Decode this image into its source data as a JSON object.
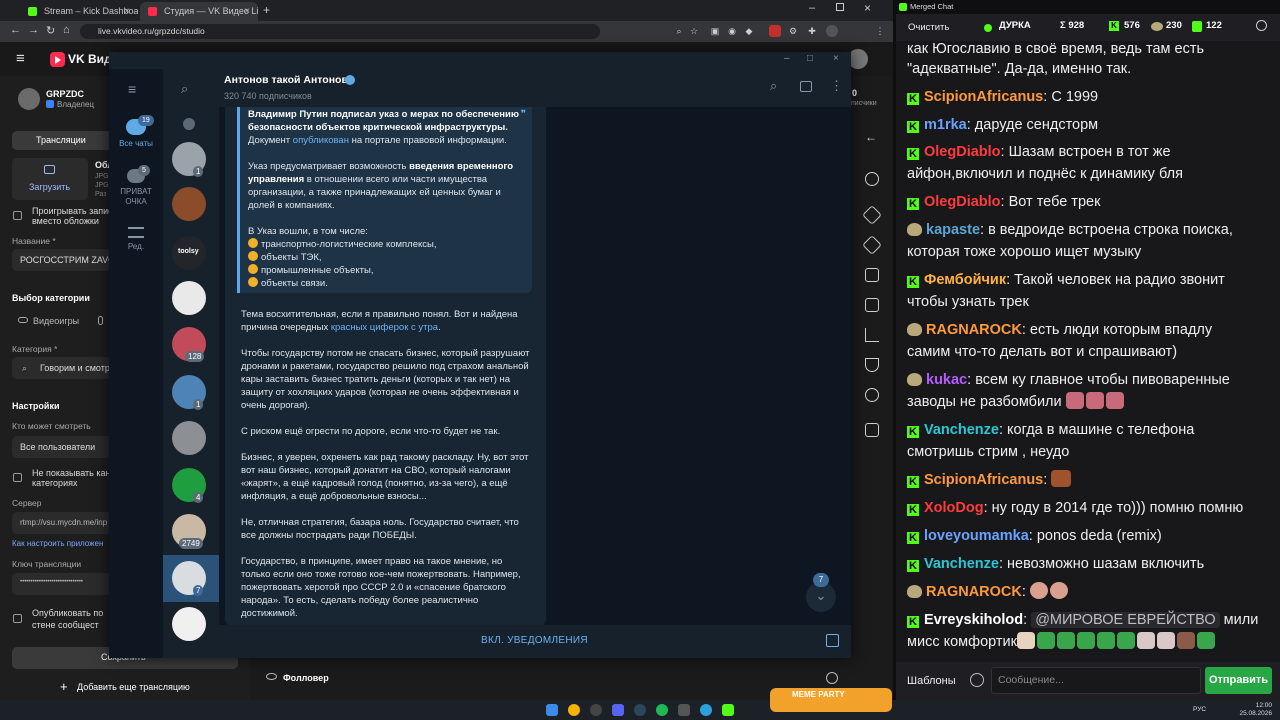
{
  "browser": {
    "tabs": [
      {
        "title": "Stream – Kick Dashboard",
        "color": "#53fc18"
      },
      {
        "title": "Студия — VK Видео Live",
        "color": "#ff2b4f"
      }
    ],
    "url": "live.vkvideo.ru/grpzdc/studio"
  },
  "vk": {
    "title": "VK Видео",
    "channel": "GRPZDC",
    "role": "Владелец",
    "tab_streams": "Трансляции",
    "cover_title": "Обл",
    "cover_hint1": "JPG",
    "cover_hint2": "JPG",
    "cover_hint3": "Раз",
    "upload": "Загрузить",
    "play_record_line1": "Проигрывать запис",
    "play_record_line2": "вместо обложки",
    "name_label": "Название *",
    "name_value": "РОСГОССТРИМ ZAVO",
    "category_choice": "Выбор категории",
    "category_games": "Видеоигры",
    "category_label": "Категория *",
    "category_value": "Говорим и смотри",
    "settings": "Настройки",
    "who_can_watch": "Кто может смотреть",
    "audience": "Все пользователи",
    "hide_line1": "Не показывать кан",
    "hide_line2": "категориях",
    "server_label": "Сервер",
    "server_value": "rtmp://vsu.mycdn.me/inp",
    "app_setup": "Как настроить приложен",
    "key_label": "Ключ трансляции",
    "key_value": "••••••••••••••••••••••••••••••",
    "publish_line1": "Опубликовать по",
    "publish_line2": "стене сообщест",
    "save": "Сохранить",
    "add_stream": "Добавить еще трансляцию",
    "follower": "Фолловер",
    "top_right_count": "0",
    "top_right_label": "писчики"
  },
  "tg": {
    "all_chats": "Все чаты",
    "all_chats_badge": "19",
    "private": "ПРИВАТ",
    "private2": "ОЧКА",
    "private_badge": "5",
    "edit": "Ред.",
    "channel_name": "Антонов такой Антонов",
    "subscribers": "320 740 подписчиков",
    "chat_badges": [
      "1",
      "128",
      "1",
      "4",
      "2749",
      "7"
    ],
    "toolsy": "toolsy",
    "quote": {
      "l1": "Владимир Путин подписал указ о мерах по обеспечению",
      "l2": "безопасности объектов критической инфраструктуры.",
      "l3a": "Документ ",
      "l3b": "опубликован",
      "l3c": " на портале правовой информации.",
      "l4a": "Указ предусматривает возможность ",
      "l4b": "введения временного",
      "l5a": "управления",
      "l5b": " в отношении всего или части имущества",
      "l6": "организации, а также принадлежащих ей ценных бумаг и",
      "l7": "долей в компаниях.",
      "l8": "В Указ вошли, в том числе:",
      "items": [
        "транспортно-логистические комплексы,",
        "объекты ТЭК,",
        "промышленные объекты,",
        "объекты связи."
      ]
    },
    "body": {
      "p1a": "Тема восхитительная, если я правильно понял. Вот и найдена",
      "p1b": "причина очередных ",
      "p1c": "красных циферок с утра",
      "p1d": ".",
      "p2a": "Чтобы государству потом не спасать бизнес, который разрушают",
      "p2b": "дронами и ракетами, государство решило под страхом анальной",
      "p2c": "кары заставить бизнес тратить деньги (которых и так нет) на",
      "p2d": "защиту от хохляцких ударов (которая не очень эффективная и",
      "p2e": "очень дорогая).",
      "p3": "С риском ещё огрести по дороге, если что-то будет не так.",
      "p4a": "Бизнес, я уверен, охренеть как рад такому раскладу. Ну, вот этот",
      "p4b": "вот наш бизнес, который донатит на СВО, который налогами",
      "p4c": "«жарят», а ещё кадровый голод (понятно, из-за чего), а ещё",
      "p4d": "инфляция, а ещё добровольные взносы...",
      "p5a": "Не, отличная стратегия, базара ноль. Государство считает, что",
      "p5b": "все должны пострадать ради ПОБЕДЫ.",
      "p6a": "Государство, в принципе, имеет право на такое мнение, но",
      "p6b": "только если оно тоже готово кое-чем пожертвовать. Например,",
      "p6c": "пожертвовать херотой про СССР 2.0 и «спасение братского",
      "p6d": "народа». То есть, сделать победу более реалистично",
      "p6e": "достижимой."
    },
    "scroll_badge": "7",
    "notify": "ВКЛ. УВЕДОМЛЕНИЯ"
  },
  "chat": {
    "window_title": "Merged Chat",
    "clear": "Очистить",
    "live_label": "ДУРКА",
    "total": "Σ 928",
    "kick": "576",
    "vk": "230",
    "other": "122",
    "messages": [
      {
        "user": "",
        "color": "#efeff1",
        "text": "как Югославию в своё время, ведь там есть"
      },
      {
        "user": "",
        "color": "#efeff1",
        "text": "\"адекватные\". Да-да, именно так."
      },
      {
        "user": "ScipionAfricanus",
        "color": "#ff9a3c",
        "text": "С 1999"
      },
      {
        "user": "m1rka",
        "color": "#6aa2ff",
        "text": "даруде сендсторм"
      },
      {
        "user": "OlegDiablo",
        "color": "#ff3c3c",
        "text": "Шазам встроен в тот же"
      },
      {
        "user": "",
        "color": "#efeff1",
        "text": "айфон,включил и поднёс к динамику бля"
      },
      {
        "user": "OlegDiablo",
        "color": "#ff3c3c",
        "text": "Вот тебе трек"
      },
      {
        "user": "kapaste",
        "color": "#5aa7d6",
        "text": "в ведроиде встроена строка поиска,"
      },
      {
        "user": "",
        "color": "#efeff1",
        "text": "которая тоже хорошо ищет музыку"
      },
      {
        "user": "Фембойчик",
        "color": "#ffb23c",
        "text": "Такой человек на радио звонит"
      },
      {
        "user": "",
        "color": "#efeff1",
        "text": "чтобы узнать трек"
      },
      {
        "user": "RAGNAROCK",
        "color": "#ff9a3c",
        "text": "есть люди которым впадлу"
      },
      {
        "user": "",
        "color": "#efeff1",
        "text": "самим что-то делать вот и спрашивают)"
      },
      {
        "user": "kukac",
        "color": "#b45cff",
        "text": "всем ку главное чтобы пивоваренные"
      },
      {
        "user": "",
        "color": "#efeff1",
        "text": "заводы не разбомбили"
      },
      {
        "user": "Vanchenze",
        "color": "#2ac8d6",
        "text": "когда в машине с телефона"
      },
      {
        "user": "",
        "color": "#efeff1",
        "text": "смотришь стрим , неудо"
      },
      {
        "user": "ScipionAfricanus",
        "color": "#ff9a3c",
        "text": ""
      },
      {
        "user": "XoloDog",
        "color": "#ff3c3c",
        "text": "ну году в 2014 где то))) помню помню"
      },
      {
        "user": "loveyoumamka",
        "color": "#6aa2ff",
        "text": "ponos deda (remix)"
      },
      {
        "user": "Vanchenze",
        "color": "#2ac8d6",
        "text": "невозможно шазам включить"
      },
      {
        "user": "RAGNAROCK",
        "color": "#ff9a3c",
        "text": ""
      },
      {
        "user": "Evreyskiholod",
        "color": "#ffffff",
        "text": "мили"
      },
      {
        "user": "",
        "color": "#efeff1",
        "text": "мисс комфортик"
      }
    ],
    "mention": "@МИРОВОЕ ЕВРЕЙСТВО",
    "templates": "Шаблоны",
    "placeholder": "Сообщение...",
    "send": "Отправить"
  },
  "taskbar": {
    "lang": "РУС",
    "time": "12:00",
    "date": "25.08.2026",
    "meme": "MEME PARTY"
  }
}
